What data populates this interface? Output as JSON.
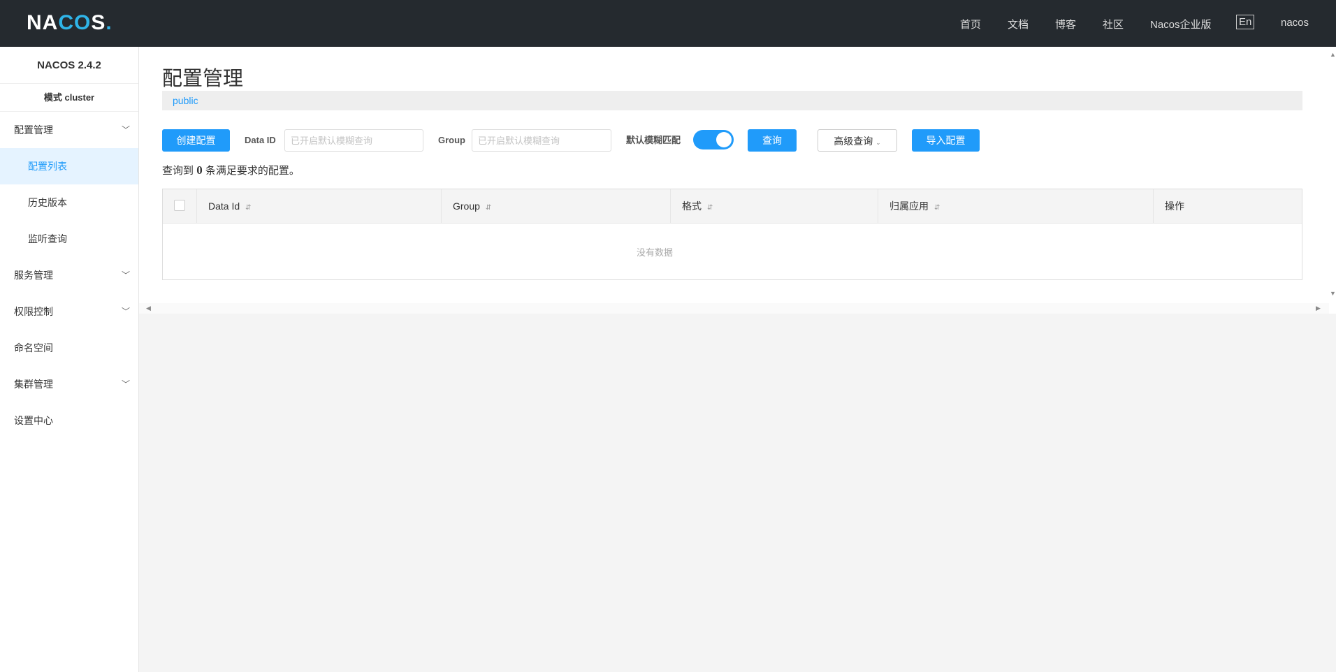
{
  "header": {
    "logo": "NACOS.",
    "nav": [
      "首页",
      "文档",
      "博客",
      "社区",
      "Nacos企业版"
    ],
    "lang": "En",
    "user": "nacos"
  },
  "sidebar": {
    "version": "NACOS 2.4.2",
    "mode": "模式 cluster",
    "items": [
      {
        "label": "配置管理",
        "expandable": true
      },
      {
        "label": "配置列表",
        "sub": true,
        "active": true
      },
      {
        "label": "历史版本",
        "sub": true
      },
      {
        "label": "监听查询",
        "sub": true
      },
      {
        "label": "服务管理",
        "expandable": true
      },
      {
        "label": "权限控制",
        "expandable": true
      },
      {
        "label": "命名空间"
      },
      {
        "label": "集群管理",
        "expandable": true
      },
      {
        "label": "设置中心"
      }
    ]
  },
  "main": {
    "title": "配置管理",
    "namespace": "public",
    "toolbar": {
      "create": "创建配置",
      "dataid_label": "Data ID",
      "dataid_placeholder": "已开启默认模糊查询",
      "group_label": "Group",
      "group_placeholder": "已开启默认模糊查询",
      "fuzzy_label": "默认模糊匹配",
      "fuzzy_on": true,
      "query": "查询",
      "advanced": "高级查询",
      "import": "导入配置"
    },
    "count_prefix": "查询到",
    "count": "0",
    "count_suffix": "条满足要求的配置。",
    "table": {
      "columns": [
        "Data Id",
        "Group",
        "格式",
        "归属应用",
        "操作"
      ],
      "empty": "没有数据"
    }
  },
  "colors": {
    "accent": "#209bfa",
    "header": "#252a2f"
  }
}
